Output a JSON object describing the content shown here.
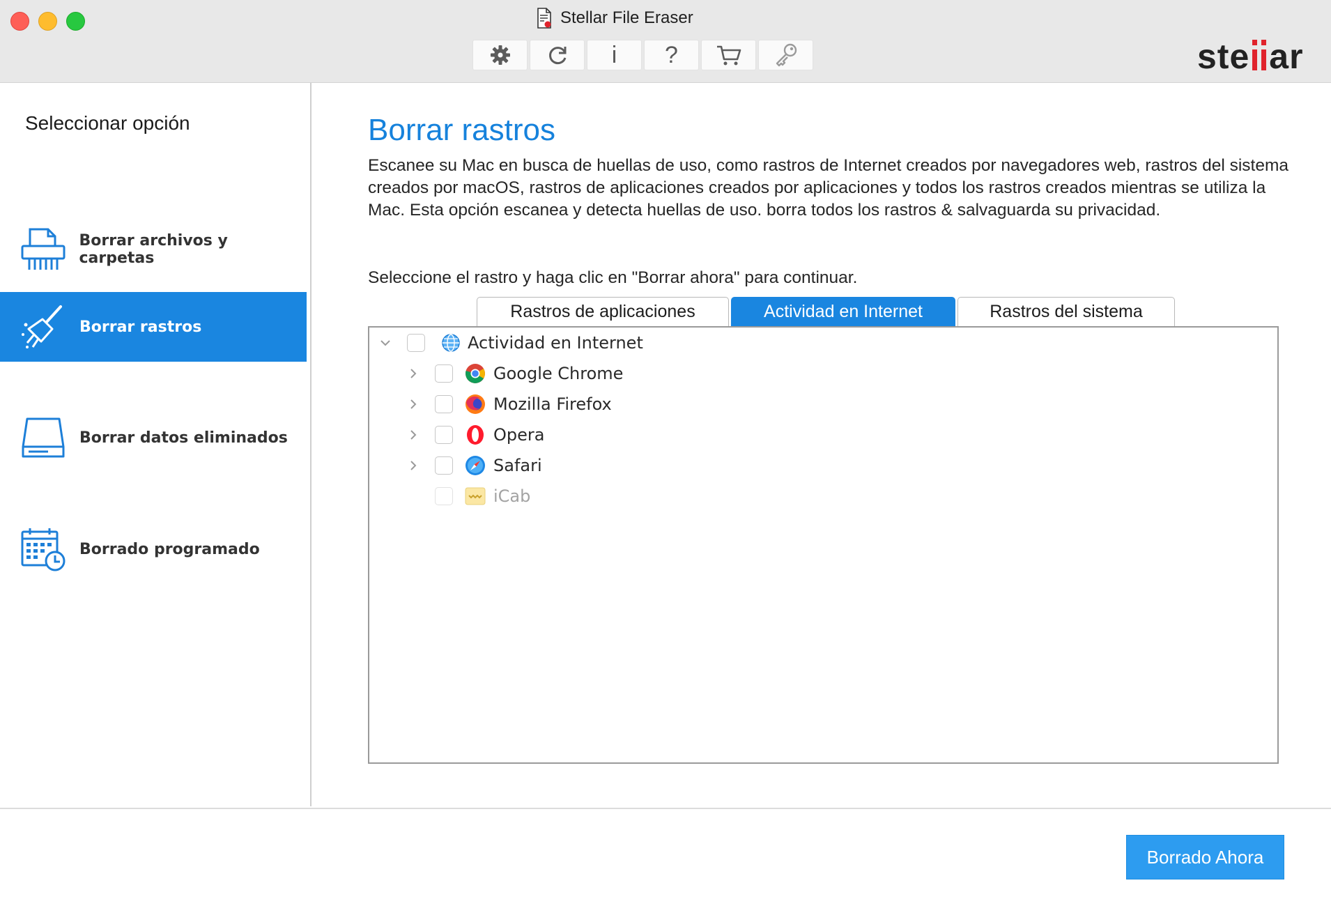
{
  "window": {
    "title": "Stellar File Eraser",
    "brand": {
      "left": "ste",
      "right": "ar"
    }
  },
  "toolbar": [
    {
      "name": "settings-button",
      "icon": "gear-icon"
    },
    {
      "name": "update-button",
      "icon": "refresh-icon"
    },
    {
      "name": "info-button",
      "icon": "info-icon",
      "glyph": "i"
    },
    {
      "name": "help-button",
      "icon": "help-icon",
      "glyph": "?"
    },
    {
      "name": "buy-button",
      "icon": "cart-icon"
    },
    {
      "name": "activate-button",
      "icon": "key-icon"
    }
  ],
  "sidebar": {
    "heading": "Seleccionar opción",
    "items": [
      {
        "label": "Borrar archivos y carpetas",
        "icon": "shredder-icon",
        "active": false
      },
      {
        "label": "Borrar rastros",
        "icon": "broom-icon",
        "active": true
      },
      {
        "label": "Borrar datos eliminados",
        "icon": "drive-icon",
        "active": false
      },
      {
        "label": "Borrado programado",
        "icon": "calendar-clock-icon",
        "active": false
      }
    ]
  },
  "main": {
    "title": "Borrar rastros",
    "description": "Escanee su Mac en busca de huellas de uso, como rastros de Internet creados por navegadores web, rastros del sistema creados por macOS, rastros de aplicaciones creados por aplicaciones y todos los rastros creados mientras se utiliza la Mac. Esta opción escanea y detecta huellas de uso. borra todos los rastros & salvaguarda su privacidad.",
    "instruction": "Seleccione el rastro y haga clic en \"Borrar ahora\" para continuar.",
    "tabs": [
      {
        "label": "Rastros de aplicaciones",
        "active": false
      },
      {
        "label": "Actividad en Internet",
        "active": true
      },
      {
        "label": "Rastros del sistema",
        "active": false
      }
    ],
    "tree": {
      "root": {
        "label": "Actividad en Internet",
        "icon": "globe-icon",
        "expanded": true,
        "checked": false
      },
      "children": [
        {
          "label": "Google Chrome",
          "icon": "chrome-icon",
          "expandable": true,
          "checked": false,
          "enabled": true
        },
        {
          "label": "Mozilla Firefox",
          "icon": "firefox-icon",
          "expandable": true,
          "checked": false,
          "enabled": true
        },
        {
          "label": "Opera",
          "icon": "opera-icon",
          "expandable": true,
          "checked": false,
          "enabled": true
        },
        {
          "label": "Safari",
          "icon": "safari-icon",
          "expandable": true,
          "checked": false,
          "enabled": true
        },
        {
          "label": "iCab",
          "icon": "icab-icon",
          "expandable": false,
          "checked": false,
          "enabled": false
        }
      ]
    }
  },
  "footer": {
    "primary_button": "Borrado Ahora"
  },
  "colors": {
    "accent": "#1a86e0",
    "title_blue": "#1682dc",
    "button_blue": "#2d9cf0",
    "brand_red": "#e0232c"
  }
}
